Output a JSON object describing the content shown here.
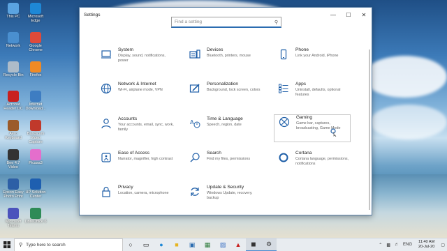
{
  "desktop": {
    "icons": [
      {
        "label": "This PC",
        "color": "#5ba3e0"
      },
      {
        "label": "Microsoft Edge",
        "color": "#1e88d6"
      },
      {
        "label": "Network",
        "color": "#4a8fcf"
      },
      {
        "label": "Google Chrome",
        "color": "#e04a3a"
      },
      {
        "label": "Recycle Bin",
        "color": "#aebcc9"
      },
      {
        "label": "Firefox",
        "color": "#f08a24"
      },
      {
        "label": "Acrobat Reader DC",
        "color": "#c8201e"
      },
      {
        "label": "Internet Download...",
        "color": "#3e7dc2"
      },
      {
        "label": "Aero Keyboard",
        "color": "#9b5b2a"
      },
      {
        "label": "Bandicam Video Capture",
        "color": "#c0392b"
      },
      {
        "label": "Bee 4.7 Video",
        "color": "#333333"
      },
      {
        "label": "Picasa3",
        "color": "#e46ecc"
      },
      {
        "label": "Epson Easy Photo Print",
        "color": "#2d5fa6"
      },
      {
        "label": "HP Solution Center",
        "color": "#1e5fb0"
      },
      {
        "label": "Microsoft Teams",
        "color": "#4b53bc"
      },
      {
        "label": "LibreOffice 6",
        "color": "#2e8b57"
      }
    ]
  },
  "window": {
    "title": "Settings",
    "controls": {
      "minimize": "—",
      "maximize": "☐",
      "close": "✕"
    },
    "search": {
      "placeholder": "Find a setting",
      "icon": "search-icon"
    }
  },
  "settings": [
    {
      "name": "System",
      "desc": "Display, sound, notifications, power",
      "icon": "laptop-icon"
    },
    {
      "name": "Devices",
      "desc": "Bluetooth, printers, mouse",
      "icon": "keyboard-icon"
    },
    {
      "name": "Phone",
      "desc": "Link your Android, iPhone",
      "icon": "phone-icon"
    },
    {
      "name": "Network & Internet",
      "desc": "Wi-Fi, airplane mode, VPN",
      "icon": "globe-icon"
    },
    {
      "name": "Personalization",
      "desc": "Background, lock screen, colors",
      "icon": "brush-icon"
    },
    {
      "name": "Apps",
      "desc": "Uninstall, defaults, optional features",
      "icon": "apps-list-icon"
    },
    {
      "name": "Accounts",
      "desc": "Your accounts, email, sync, work, family",
      "icon": "person-icon"
    },
    {
      "name": "Time & Language",
      "desc": "Speech, region, date",
      "icon": "time-language-icon"
    },
    {
      "name": "Gaming",
      "desc": "Game bar, captures, broadcasting, Game Mode",
      "icon": "xbox-icon"
    },
    {
      "name": "Ease of Access",
      "desc": "Narrator, magnifier, high contrast",
      "icon": "ease-of-access-icon"
    },
    {
      "name": "Search",
      "desc": "Find my files, permissions",
      "icon": "magnifier-icon"
    },
    {
      "name": "Cortana",
      "desc": "Cortana language, permissions, notifications",
      "icon": "cortana-ring-icon"
    },
    {
      "name": "Privacy",
      "desc": "Location, camera, microphone",
      "icon": "lock-icon"
    },
    {
      "name": "Update & Security",
      "desc": "Windows Update, recovery, backup",
      "icon": "sync-icon"
    }
  ],
  "taskbar": {
    "search_placeholder": "Type here to search",
    "time": "11:40 AM",
    "date": "20-Jul-20",
    "tray_text": "ENG"
  },
  "colors": {
    "accent": "#1f5fa8",
    "window_bg": "#ffffff",
    "taskbar_bg": "#e8ecf0"
  }
}
